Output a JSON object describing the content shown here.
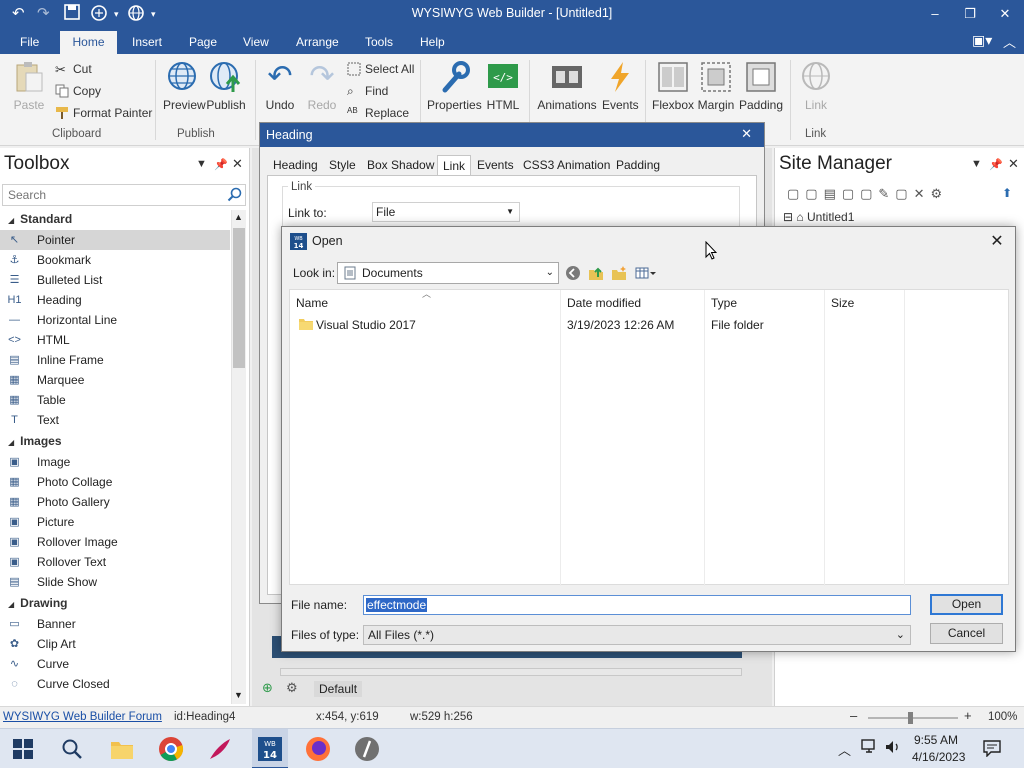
{
  "window": {
    "title": "WYSIWYG Web Builder - [Untitled1]",
    "controls": [
      "–",
      "❐",
      "✕"
    ]
  },
  "menu": {
    "tabs": [
      "File",
      "Home",
      "Insert",
      "Page",
      "View",
      "Arrange",
      "Tools",
      "Help"
    ],
    "active": "Home"
  },
  "ribbon": {
    "clipboard": {
      "paste": "Paste",
      "cut": "Cut",
      "copy": "Copy",
      "format_painter": "Format Painter",
      "label": "Clipboard"
    },
    "publish": {
      "preview": "Preview",
      "publish": "Publish",
      "label": "Publish"
    },
    "edit": {
      "undo": "Undo",
      "redo": "Redo",
      "select_all": "Select All",
      "find": "Find",
      "replace": "Replace"
    },
    "props": {
      "properties": "Properties",
      "html": "HTML"
    },
    "anim": {
      "animations": "Animations",
      "events": "Events"
    },
    "layout": {
      "flexbox": "Flexbox",
      "margin": "Margin",
      "padding": "Padding"
    },
    "link": {
      "link": "Link",
      "label": "Link"
    }
  },
  "toolbox": {
    "title": "Toolbox",
    "search_placeholder": "Search",
    "sections": [
      {
        "name": "Standard",
        "items": [
          {
            "label": "Pointer",
            "icon": "↖",
            "selected": true
          },
          {
            "label": "Bookmark",
            "icon": "⚓"
          },
          {
            "label": "Bulleted List",
            "icon": "☰"
          },
          {
            "label": "Heading",
            "icon": "H1"
          },
          {
            "label": "Horizontal Line",
            "icon": "—"
          },
          {
            "label": "HTML",
            "icon": "<>"
          },
          {
            "label": "Inline Frame",
            "icon": "▤"
          },
          {
            "label": "Marquee",
            "icon": "▦"
          },
          {
            "label": "Table",
            "icon": "▦"
          },
          {
            "label": "Text",
            "icon": "T"
          }
        ]
      },
      {
        "name": "Images",
        "items": [
          {
            "label": "Image",
            "icon": "▣"
          },
          {
            "label": "Photo Collage",
            "icon": "▦"
          },
          {
            "label": "Photo Gallery",
            "icon": "▦"
          },
          {
            "label": "Picture",
            "icon": "▣"
          },
          {
            "label": "Rollover Image",
            "icon": "▣"
          },
          {
            "label": "Rollover Text",
            "icon": "▣"
          },
          {
            "label": "Slide Show",
            "icon": "▤"
          }
        ]
      },
      {
        "name": "Drawing",
        "items": [
          {
            "label": "Banner",
            "icon": "▭"
          },
          {
            "label": "Clip Art",
            "icon": "✿"
          },
          {
            "label": "Curve",
            "icon": "∿"
          },
          {
            "label": "Curve Closed",
            "icon": "◌"
          }
        ]
      }
    ]
  },
  "site_manager": {
    "title": "Site Manager",
    "tree_root": "Untitled1"
  },
  "heading_dialog": {
    "title": "Heading",
    "tabs": [
      "Heading",
      "Style",
      "Box Shadow",
      "Link",
      "Events",
      "CSS3 Animation",
      "Padding"
    ],
    "active_tab": "Link",
    "group_label": "Link",
    "link_to_label": "Link to:",
    "link_to_value": "File"
  },
  "open_dialog": {
    "title": "Open",
    "look_in_label": "Look in:",
    "look_in_value": "Documents",
    "columns": [
      "Name",
      "Date modified",
      "Type",
      "Size"
    ],
    "files": [
      {
        "name": "Visual Studio 2017",
        "date": "3/19/2023 12:26 AM",
        "type": "File folder",
        "size": ""
      }
    ],
    "file_name_label": "File name:",
    "file_name_value": "effectmode",
    "files_of_type_label": "Files of type:",
    "files_of_type_value": "All Files (*.*)",
    "open_button": "Open",
    "cancel_button": "Cancel"
  },
  "workspace": {
    "default_label": "Default"
  },
  "statusbar": {
    "forum_link": "WYSIWYG Web Builder Forum",
    "id": "id:Heading4",
    "coords": "x:454, y:619",
    "size": "w:529 h:256",
    "zoom": "100%"
  },
  "taskbar": {
    "time": "9:55 AM",
    "date": "4/16/2023"
  },
  "colors": {
    "accent": "#2b579a",
    "selection": "#2e68c7"
  }
}
